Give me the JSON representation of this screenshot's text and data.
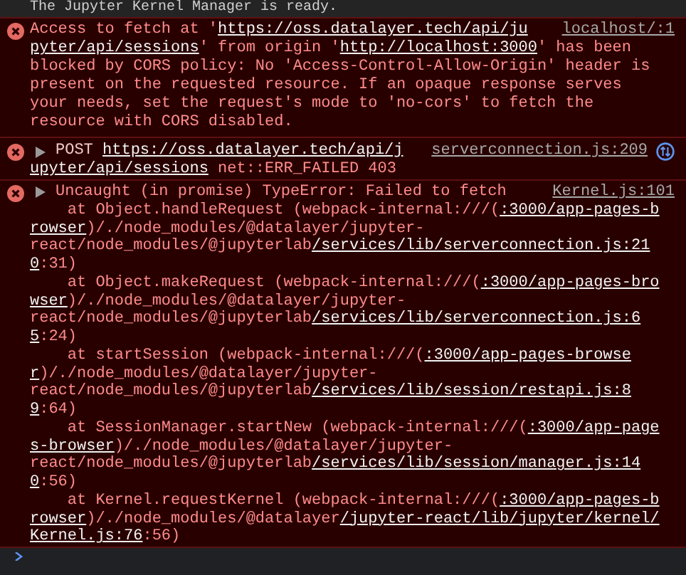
{
  "previous_message": {
    "text": "The Jupyter Kernel Manager is ready."
  },
  "messages": [
    {
      "kind": "error",
      "disclosure_triangle": false,
      "network_request": false,
      "source": "localhost/:1",
      "lines": [
        [
          {
            "kind": "text",
            "text": "Access to fetch at '"
          },
          {
            "kind": "link",
            "text": "https://oss.datalayer.tech/api/ju"
          }
        ],
        [
          {
            "kind": "link",
            "text": "pyter/api/sessions"
          },
          {
            "kind": "text",
            "text": "' from origin '"
          },
          {
            "kind": "link",
            "text": "http://localhost:3000"
          },
          {
            "kind": "text",
            "text": "' has been"
          }
        ],
        [
          {
            "kind": "text",
            "text": "blocked by CORS policy: No 'Access-Control-Allow-Origin' header is"
          }
        ],
        [
          {
            "kind": "text",
            "text": "present on the requested resource. If an opaque response serves"
          }
        ],
        [
          {
            "kind": "text",
            "text": "your needs, set the request's mode to 'no-cors' to fetch the"
          }
        ],
        [
          {
            "kind": "text",
            "text": "resource with CORS disabled."
          }
        ]
      ]
    },
    {
      "kind": "error",
      "disclosure_triangle": true,
      "network_request": true,
      "source": "serverconnection.js:209",
      "lines": [
        [
          {
            "kind": "method",
            "text": "POST "
          },
          {
            "kind": "link",
            "text": "https://oss.datalayer.tech/api/j"
          }
        ],
        [
          {
            "kind": "link",
            "text": "upyter/api/sessions"
          },
          {
            "kind": "text",
            "text": " net::ERR_FAILED 403"
          }
        ]
      ]
    },
    {
      "kind": "error",
      "disclosure_triangle": true,
      "network_request": false,
      "source": "Kernel.js:101",
      "lines": [
        [
          {
            "kind": "text",
            "text": "Uncaught (in promise) TypeError: Failed to fetch"
          }
        ],
        [
          {
            "kind": "text",
            "text": "    at Object.handleRequest (webpack-internal:///("
          },
          {
            "kind": "link",
            "text": ":3000/app-pages-b"
          }
        ],
        [
          {
            "kind": "link",
            "text": "rowser"
          },
          {
            "kind": "text",
            "text": ")/./node_modules/@datalayer/jupyter-"
          }
        ],
        [
          {
            "kind": "text",
            "text": "react/node_modules/@jupyterlab"
          },
          {
            "kind": "link",
            "text": "/services/lib/serverconnection.js:21"
          }
        ],
        [
          {
            "kind": "link",
            "text": "0"
          },
          {
            "kind": "text",
            "text": ":31)"
          }
        ],
        [
          {
            "kind": "text",
            "text": "    at Object.makeRequest (webpack-internal:///("
          },
          {
            "kind": "link",
            "text": ":3000/app-pages-bro"
          }
        ],
        [
          {
            "kind": "link",
            "text": "wser"
          },
          {
            "kind": "text",
            "text": ")/./node_modules/@datalayer/jupyter-"
          }
        ],
        [
          {
            "kind": "text",
            "text": "react/node_modules/@jupyterlab"
          },
          {
            "kind": "link",
            "text": "/services/lib/serverconnection.js:6"
          }
        ],
        [
          {
            "kind": "link",
            "text": "5"
          },
          {
            "kind": "text",
            "text": ":24)"
          }
        ],
        [
          {
            "kind": "text",
            "text": "    at startSession (webpack-internal:///("
          },
          {
            "kind": "link",
            "text": ":3000/app-pages-browse"
          }
        ],
        [
          {
            "kind": "link",
            "text": "r"
          },
          {
            "kind": "text",
            "text": ")/./node_modules/@datalayer/jupyter-"
          }
        ],
        [
          {
            "kind": "text",
            "text": "react/node_modules/@jupyterlab"
          },
          {
            "kind": "link",
            "text": "/services/lib/session/restapi.js:8"
          }
        ],
        [
          {
            "kind": "link",
            "text": "9"
          },
          {
            "kind": "text",
            "text": ":64)"
          }
        ],
        [
          {
            "kind": "text",
            "text": "    at SessionManager.startNew (webpack-internal:///("
          },
          {
            "kind": "link",
            "text": ":3000/app-page"
          }
        ],
        [
          {
            "kind": "link",
            "text": "s-browser"
          },
          {
            "kind": "text",
            "text": ")/./node_modules/@datalayer/jupyter-"
          }
        ],
        [
          {
            "kind": "text",
            "text": "react/node_modules/@jupyterlab"
          },
          {
            "kind": "link",
            "text": "/services/lib/session/manager.js:14"
          }
        ],
        [
          {
            "kind": "link",
            "text": "0"
          },
          {
            "kind": "text",
            "text": ":56)"
          }
        ],
        [
          {
            "kind": "text",
            "text": "    at Kernel.requestKernel (webpack-internal:///("
          },
          {
            "kind": "link",
            "text": ":3000/app-pages-b"
          }
        ],
        [
          {
            "kind": "link",
            "text": "rowser"
          },
          {
            "kind": "text",
            "text": ")/./node_modules/@datalayer"
          },
          {
            "kind": "link",
            "text": "/jupyter-react/lib/jupyter/kernel/"
          }
        ],
        [
          {
            "kind": "link",
            "text": "Kernel.js:76"
          },
          {
            "kind": "text",
            "text": ":56)"
          }
        ]
      ]
    }
  ]
}
